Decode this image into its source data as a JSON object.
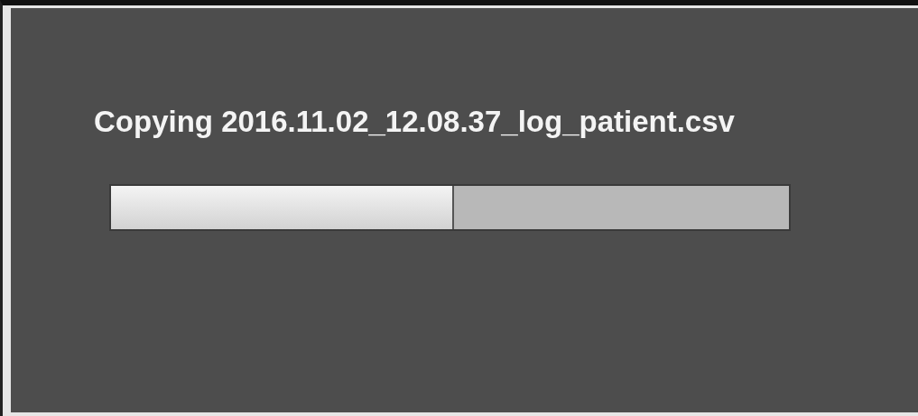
{
  "dialog": {
    "message": "Copying 2016.11.02_12.08.37_log_patient.csv",
    "progress": {
      "level": 0.506
    }
  }
}
